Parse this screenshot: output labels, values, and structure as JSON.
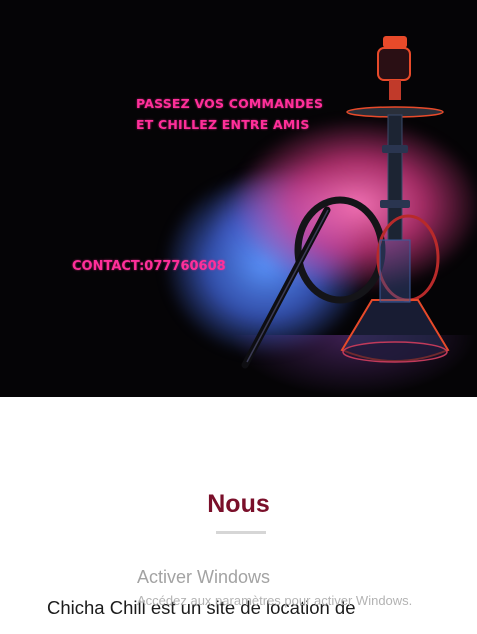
{
  "hero": {
    "promo_line_1": "PASSEZ VOS COMMANDES",
    "promo_line_2": "ET CHILLEZ ENTRE AMIS",
    "contact": "CONTACT:077760608",
    "image_subject": "hookah-with-neon-smoke",
    "colors": {
      "background": "#050406",
      "promo_text": "#ff2f9a",
      "smoke_blue": "#5a96ff",
      "smoke_pink": "#e63c8c",
      "hookah_accent": "#e84a2a"
    }
  },
  "section": {
    "title": "Nous",
    "title_color": "#7a0f2a",
    "intro": "Chicha Chill est un site de location de"
  },
  "windows_watermark": {
    "title": "Activer Windows",
    "subtitle": "Accédez aux paramètres pour activer Windows."
  }
}
